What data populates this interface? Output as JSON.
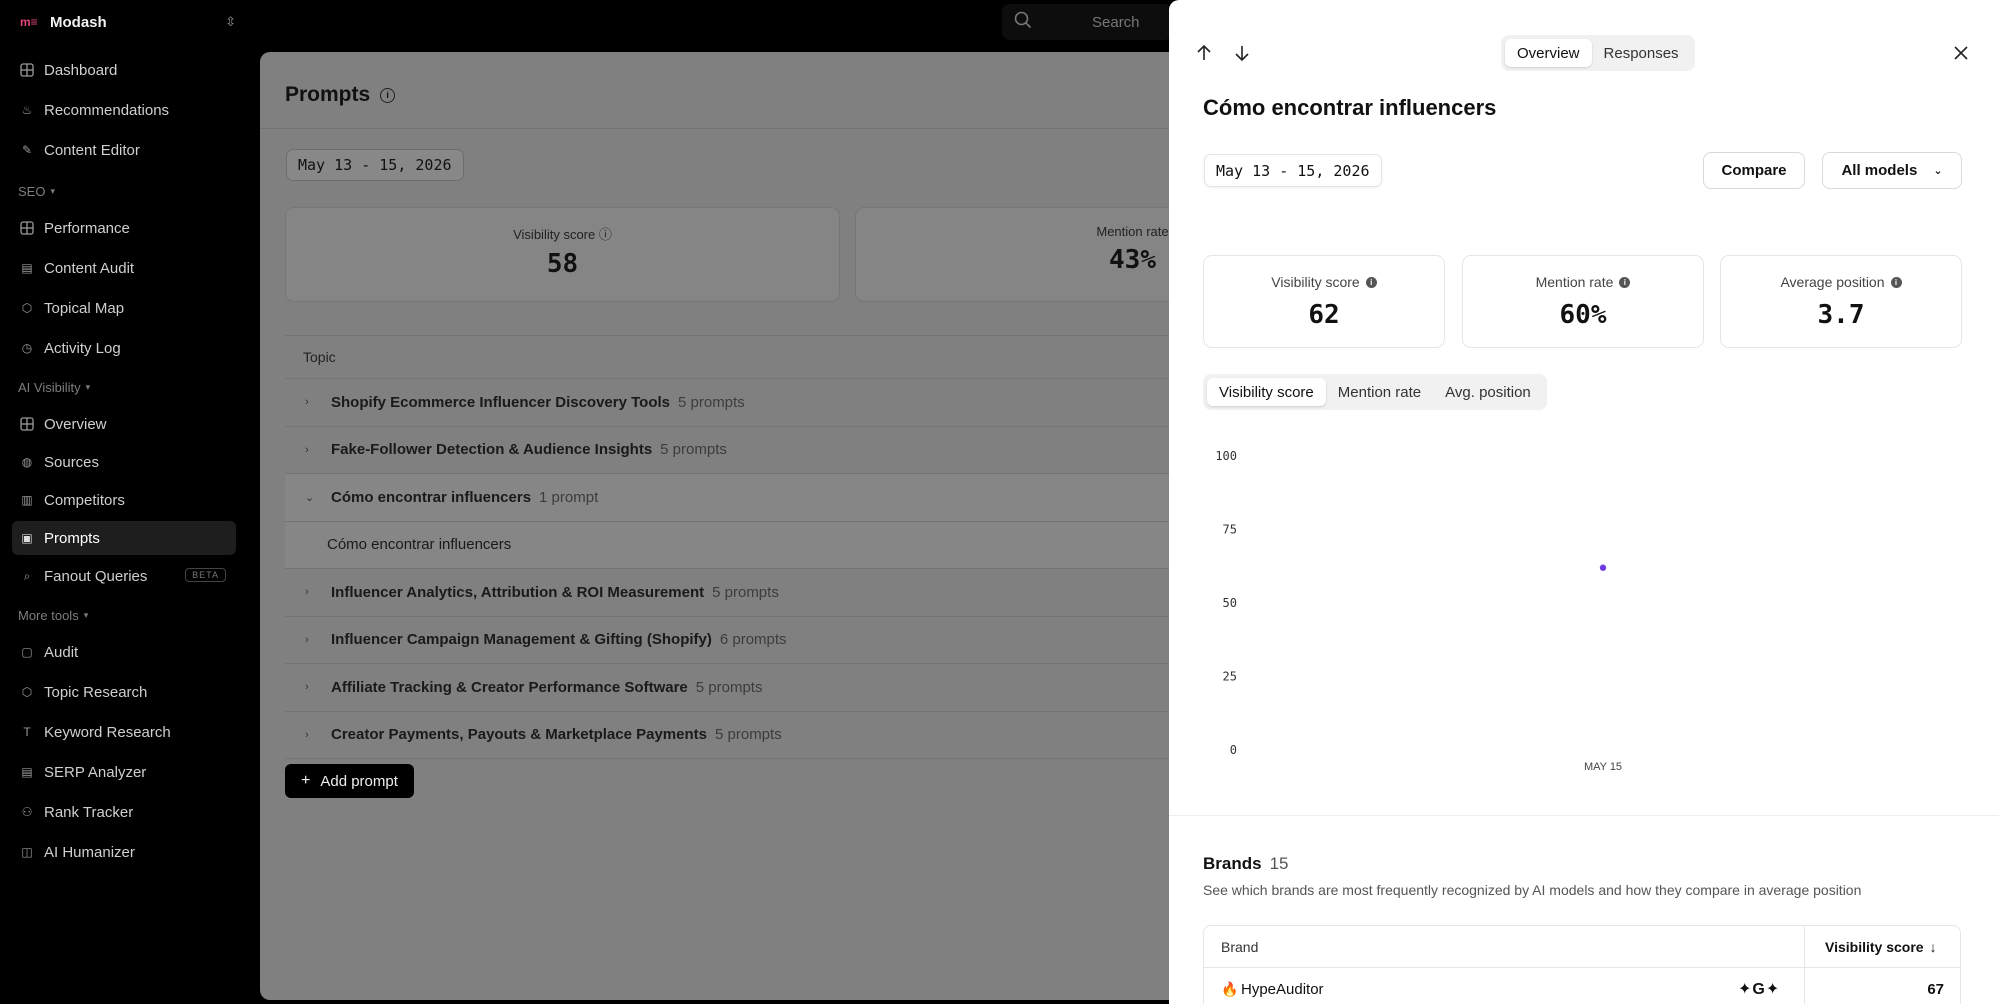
{
  "app": {
    "name": "Modash",
    "logo_text": "m≡"
  },
  "sidebar": {
    "items_top": [
      {
        "label": "Dashboard",
        "icon": "grid-icon"
      },
      {
        "label": "Recommendations",
        "icon": "flame-icon"
      },
      {
        "label": "Content Editor",
        "icon": "pen-icon"
      }
    ],
    "seo_label": "SEO",
    "seo_items": [
      {
        "label": "Performance",
        "icon": "grid-icon"
      },
      {
        "label": "Content Audit",
        "icon": "doc-icon"
      },
      {
        "label": "Topical Map",
        "icon": "hexagon-icon"
      },
      {
        "label": "Activity Log",
        "icon": "clock-icon"
      }
    ],
    "ai_label": "AI Visibility",
    "ai_items": [
      {
        "label": "Overview",
        "icon": "grid-icon"
      },
      {
        "label": "Sources",
        "icon": "globe-icon"
      },
      {
        "label": "Competitors",
        "icon": "building-icon"
      },
      {
        "label": "Prompts",
        "icon": "prompt-icon"
      },
      {
        "label": "Fanout Queries",
        "icon": "search-icon",
        "badge": "BETA"
      }
    ],
    "more_label": "More tools",
    "more_items": [
      {
        "label": "Audit",
        "icon": "clipboard-icon"
      },
      {
        "label": "Topic Research",
        "icon": "hexagon-icon"
      },
      {
        "label": "Keyword Research",
        "icon": "type-icon"
      },
      {
        "label": "SERP Analyzer",
        "icon": "serp-icon"
      },
      {
        "label": "Rank Tracker",
        "icon": "medal-icon"
      },
      {
        "label": "AI Humanizer",
        "icon": "ai-icon"
      }
    ]
  },
  "search": {
    "placeholder": "Search"
  },
  "main": {
    "title": "Prompts",
    "date_range": "May 13 - 15, 2026",
    "stats": [
      {
        "label": "Visibility score",
        "value": "58"
      },
      {
        "label": "Mention rate",
        "value": "43%"
      }
    ],
    "table_header": "Topic",
    "rows": [
      {
        "name": "Shopify Ecommerce Influencer Discovery Tools",
        "count": "5 prompts",
        "expanded": false
      },
      {
        "name": "Fake-Follower Detection & Audience Insights",
        "count": "5 prompts",
        "expanded": false
      },
      {
        "name": "Cómo encontrar influencers",
        "count": "1 prompt",
        "expanded": true
      },
      {
        "name": "Cómo encontrar influencers",
        "count": "",
        "child": true
      },
      {
        "name": "Influencer Analytics, Attribution & ROI Measurement",
        "count": "5 prompts",
        "expanded": false
      },
      {
        "name": "Influencer Campaign Management & Gifting (Shopify)",
        "count": "6 prompts",
        "expanded": false
      },
      {
        "name": "Affiliate Tracking & Creator Performance Software",
        "count": "5 prompts",
        "expanded": false
      },
      {
        "name": "Creator Payments, Payouts & Marketplace Payments",
        "count": "5 prompts",
        "expanded": false
      }
    ],
    "add_prompt": "Add prompt"
  },
  "panel": {
    "tabs": [
      "Overview",
      "Responses"
    ],
    "active_tab": "Overview",
    "title": "Cómo encontrar influencers",
    "date_range": "May 13 - 15, 2026",
    "compare_label": "Compare",
    "models_label": "All models",
    "stats": [
      {
        "label": "Visibility score",
        "value": "62"
      },
      {
        "label": "Mention rate",
        "value": "60%"
      },
      {
        "label": "Average position",
        "value": "3.7"
      }
    ],
    "metric_tabs": [
      "Visibility score",
      "Mention rate",
      "Avg. position"
    ],
    "active_metric": "Visibility score",
    "brands": {
      "title": "Brands",
      "count": "15",
      "description": "See which brands are most frequently recognized by AI models and how they compare in average position",
      "col_brand": "Brand",
      "col_score": "Visibility score",
      "rows": [
        {
          "name": "HypeAuditor",
          "models": "✦G✦",
          "score": "67"
        }
      ]
    }
  },
  "chart_data": {
    "type": "scatter",
    "x": [
      "MAY 15"
    ],
    "series": [
      {
        "values": [
          62
        ]
      }
    ],
    "yticks": [
      "100",
      "75",
      "50",
      "25",
      "0"
    ],
    "ylim": [
      0,
      100
    ],
    "color": "#6c3ce0",
    "grid": false
  }
}
